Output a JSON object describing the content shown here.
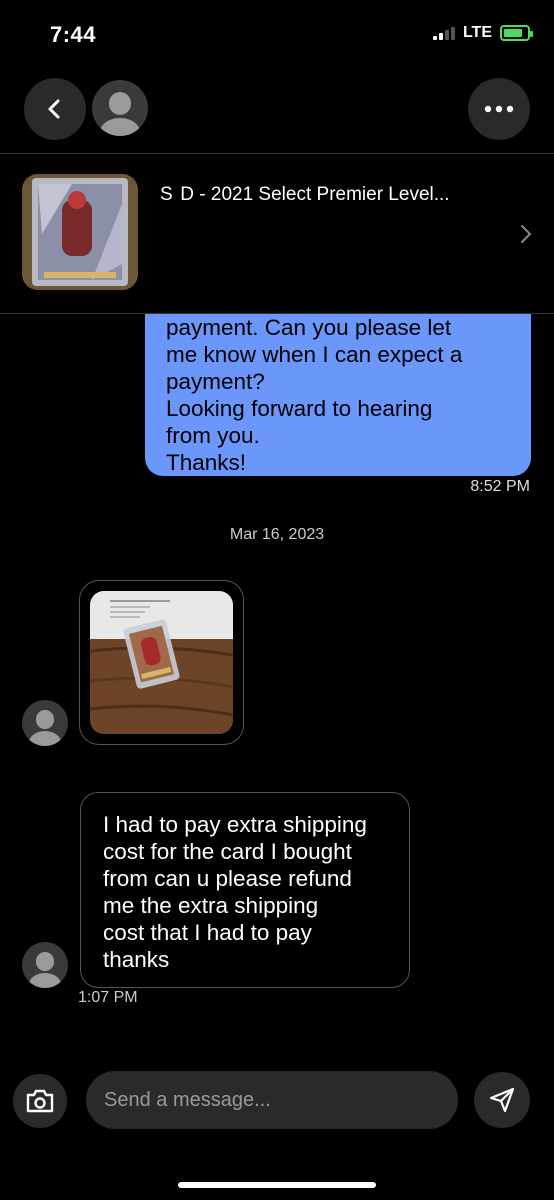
{
  "status_bar": {
    "time": "7:44",
    "network": "LTE",
    "battery_charging": true
  },
  "header": {
    "back_icon": "chevron-left-icon",
    "more_icon": "ellipsis-icon"
  },
  "item": {
    "title": "S  D - 2021 Select Premier Level..."
  },
  "messages": {
    "sent": {
      "lines": [
        "payment. Can you please let",
        "me know when I can expect a",
        "payment?",
        "Looking forward to hearing",
        "from you.",
        "Thanks!"
      ],
      "time": "8:52 PM"
    },
    "date_divider": "Mar 16, 2023",
    "received": {
      "lines": [
        "I had to pay extra shipping",
        "cost for the card I bought",
        "from can u please refund",
        "me the extra shipping",
        "cost that I had to pay",
        "thanks"
      ],
      "time": "1:07 PM"
    }
  },
  "composer": {
    "placeholder": "Send a message...",
    "camera_icon": "camera-icon",
    "send_icon": "send-icon"
  },
  "colors": {
    "sent_bubble": "#6b97fb",
    "background": "#000000",
    "control_bg": "#2a2a2a"
  }
}
